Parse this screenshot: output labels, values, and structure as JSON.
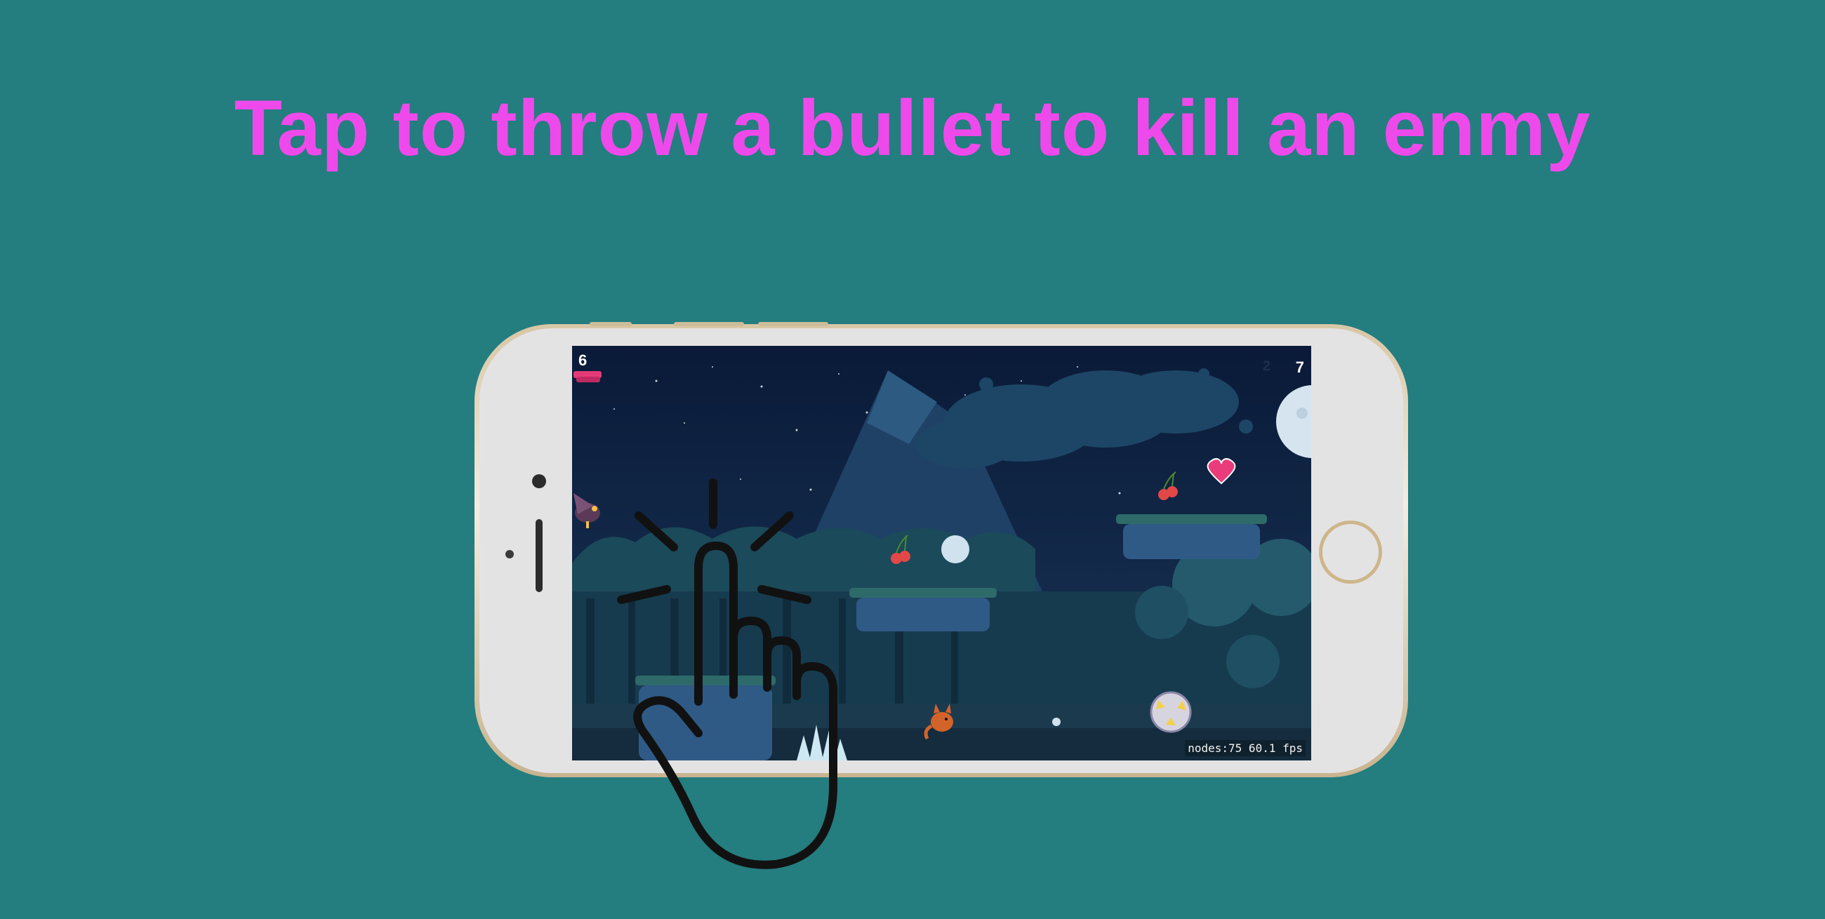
{
  "headline": "Tap to throw a bullet to kill an enmy",
  "colors": {
    "background": "#247d7f",
    "headline": "#ee4aeb",
    "sky": "#0c1d3d",
    "hand_outline": "#111111"
  },
  "game": {
    "score_left": "6",
    "score_right": "7",
    "score_mid": "2",
    "debug_stats": "nodes:75  60.1 fps"
  },
  "icons": {
    "lives": "heart-stack-icon",
    "collectible": "cherry-icon",
    "health": "heart-icon",
    "player": "fox-icon",
    "enemy_flying": "eagle-icon",
    "enemy_ground": "spiky-ball-icon",
    "hazard": "spikes-icon",
    "gesture": "tap-hand-icon"
  }
}
